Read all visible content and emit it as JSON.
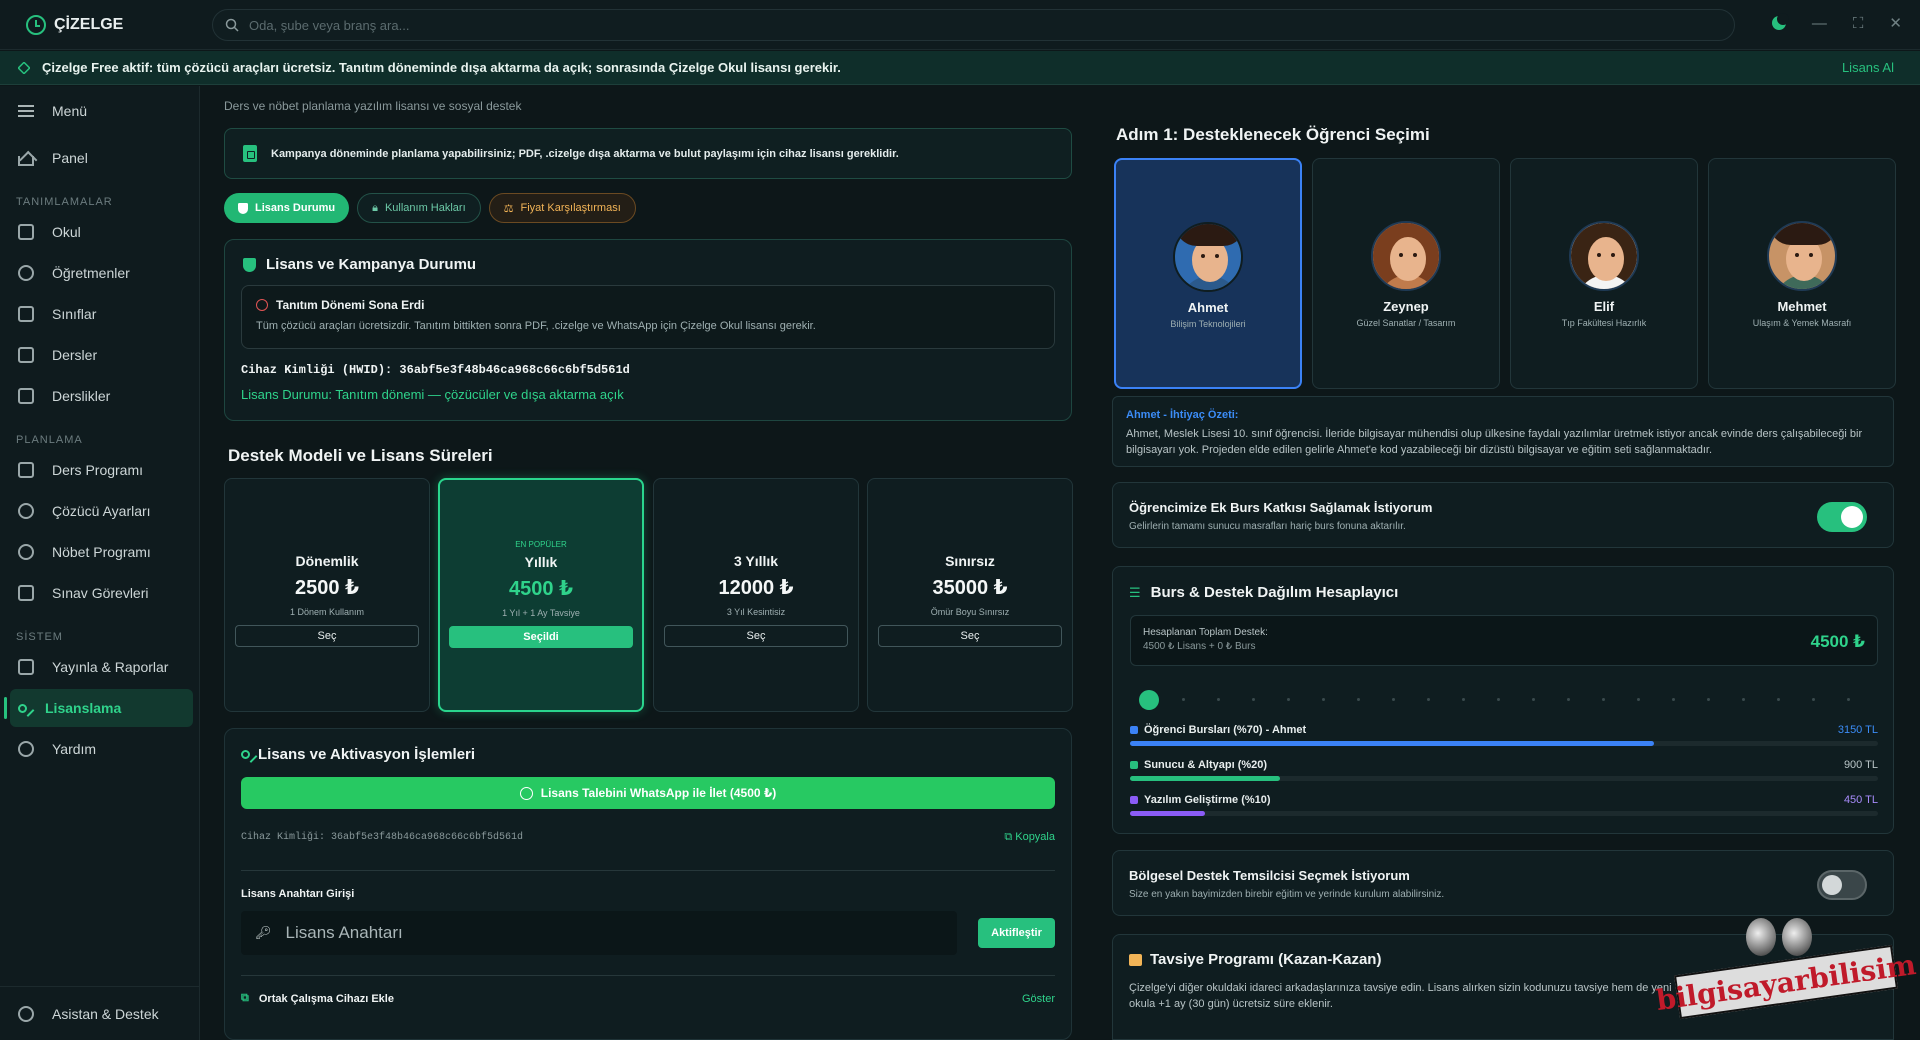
{
  "app": {
    "brand": "ÇİZELGE",
    "search_placeholder": "Oda, şube veya branş ara..."
  },
  "banner": {
    "text": "Çizelge Free aktif: tüm çözücü araçları ücretsiz. Tanıtım döneminde dışa aktarma da açık; sonrasında Çizelge Okul lisansı gerekir.",
    "action": "Lisans Al"
  },
  "sidebar": {
    "menu": "Menü",
    "panel": "Panel",
    "sections": {
      "tanim": "TANIMLAMALAR",
      "plan": "PLANLAMA",
      "sistem": "SİSTEM"
    },
    "items": [
      "Okul",
      "Öğretmenler",
      "Sınıflar",
      "Dersler",
      "Derslikler",
      "Ders Programı",
      "Çözücü Ayarları",
      "Nöbet Programı",
      "Sınav Görevleri",
      "Yayınla & Raporlar",
      "Lisanslama",
      "Yardım"
    ],
    "bottom": "Asistan & Destek"
  },
  "page": {
    "subtitle": "Ders ve nöbet planlama yazılım lisansı ve sosyal destek",
    "info": "Kampanya döneminde planlama yapabilirsiniz; PDF, .cizelge dışa aktarma ve bulut paylaşımı için cihaz lisansı gereklidir.",
    "tabs": [
      "Lisans Durumu",
      "Kullanım Hakları",
      "Fiyat Karşılaştırması"
    ]
  },
  "license": {
    "title": "Lisans ve Kampanya Durumu",
    "warn_title": "Tanıtım Dönemi Sona Erdi",
    "warn_desc": "Tüm çözücü araçları ücretsizdir. Tanıtım bittikten sonra PDF, .cizelge ve WhatsApp için Çizelge Okul lisansı gerekir.",
    "hwid": "Cihaz Kimliği (HWID): 36abf5e3f48b46ca968c66c6bf5d561d",
    "status": "Lisans Durumu: Tanıtım dönemi — çözücüler ve dışa aktarma açık"
  },
  "plans": {
    "title": "Destek Modeli ve Lisans Süreleri",
    "items": [
      {
        "popular": "",
        "name": "Dönemlik",
        "price": "2500 ₺",
        "sub": "1 Dönem Kullanım",
        "btn": "Seç"
      },
      {
        "popular": "EN POPÜLER",
        "name": "Yıllık",
        "price": "4500 ₺",
        "sub": "1 Yıl + 1 Ay Tavsiye",
        "btn": "Seçildi"
      },
      {
        "popular": "",
        "name": "3 Yıllık",
        "price": "12000 ₺",
        "sub": "3 Yıl Kesintisiz",
        "btn": "Seç"
      },
      {
        "popular": "",
        "name": "Sınırsız",
        "price": "35000 ₺",
        "sub": "Ömür Boyu Sınırsız",
        "btn": "Seç"
      }
    ]
  },
  "activation": {
    "title": "Lisans ve Aktivasyon İşlemleri",
    "wa_btn": "Lisans Talebini WhatsApp ile İlet (4500 ₺)",
    "hwid": "Cihaz Kimliği: 36abf5e3f48b46ca968c66c6bf5d561d",
    "copy": "Kopyala",
    "key_label": "Lisans Anahtarı Girişi",
    "key_placeholder": "Lisans Anahtarı",
    "activate": "Aktifleştir",
    "device": "Ortak Çalışma Cihazı Ekle",
    "show": "Göster"
  },
  "students": {
    "title": "Adım 1: Desteklenecek Öğrenci Seçimi",
    "items": [
      {
        "name": "Ahmet",
        "desc": "Bilişim Teknolojileri"
      },
      {
        "name": "Zeynep",
        "desc": "Güzel Sanatlar / Tasarım"
      },
      {
        "name": "Elif",
        "desc": "Tıp Fakültesi Hazırlık"
      },
      {
        "name": "Mehmet",
        "desc": "Ulaşım & Yemek Masrafı"
      }
    ],
    "need_title": "Ahmet - İhtiyaç Özeti:",
    "need_desc": "Ahmet, Meslek Lisesi 10. sınıf öğrencisi. İleride bilgisayar mühendisi olup ülkesine faydalı yazılımlar üretmek istiyor ancak evinde ders çalışabileceği bir bilgisayarı yok. Projeden elde edilen gelirle Ahmet'e kod yazabileceği bir dizüstü bilgisayar ve eğitim seti sağlanmaktadır."
  },
  "scholarship": {
    "title": "Öğrencimize Ek Burs Katkısı Sağlamak İstiyorum",
    "desc": "Gelirlerin tamamı sunucu masrafları hariç burs fonuna aktarılır.",
    "enabled": true
  },
  "calc": {
    "title": "Burs & Destek Dağılım Hesaplayıcı",
    "total_label": "Hesaplanan Toplam Destek:",
    "total_sub": "4500 ₺ Lisans + 0 ₺ Burs",
    "total_value": "4500 ₺",
    "slider_value": 0,
    "rows": [
      {
        "label": "Öğrenci Bursları (%70) - Ahmet",
        "amount": "3150 TL",
        "fraction": 0.7,
        "color": "#3b82f6"
      },
      {
        "label": "Sunucu & Altyapı (%20)",
        "amount": "900 TL",
        "fraction": 0.2,
        "color": "#27c07e"
      },
      {
        "label": "Yazılım Geliştirme (%10)",
        "amount": "450 TL",
        "fraction": 0.1,
        "color": "#8b5cf6"
      }
    ]
  },
  "regional": {
    "title": "Bölgesel Destek Temsilcisi Seçmek İstiyorum",
    "desc": "Size en yakın bayimizden birebir eğitim ve yerinde kurulum alabilirsiniz.",
    "enabled": false
  },
  "referral": {
    "title": "Tavsiye Programı (Kazan-Kazan)",
    "desc": "Çizelge'yi diğer okuldaki idareci arkadaşlarınıza tavsiye edin. Lisans alırken sizin kodunuzu tavsiye hem de yeni okula +1 ay (30 gün) ücretsiz süre eklenir."
  },
  "watermark": {
    "text": "bilgisayarbilisim"
  }
}
